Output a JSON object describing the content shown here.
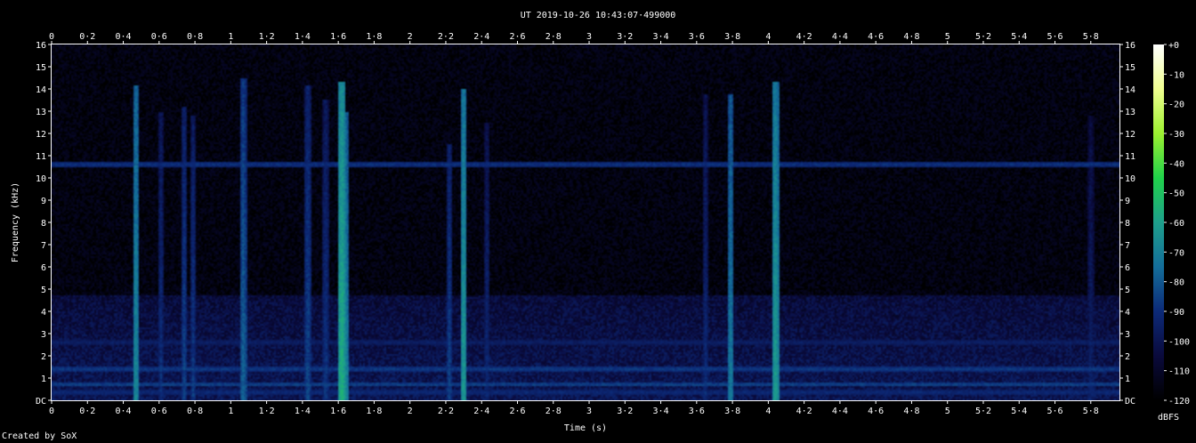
{
  "chart_data": {
    "type": "heatmap",
    "title": "UT 2019-10-26 10:43:07·499000",
    "xlabel": "Time (s)",
    "ylabel": "Frequency (kHz)",
    "xlim": [
      0,
      5.96
    ],
    "ylim": [
      0,
      16
    ],
    "x_ticks": [
      "0",
      "0·2",
      "0·4",
      "0·6",
      "0·8",
      "1",
      "1·2",
      "1·4",
      "1·6",
      "1·8",
      "2",
      "2·2",
      "2·4",
      "2·6",
      "2·8",
      "3",
      "3·2",
      "3·4",
      "3·6",
      "3·8",
      "4",
      "4·2",
      "4·4",
      "4·6",
      "4·8",
      "5",
      "5·2",
      "5·4",
      "5·6",
      "5·8"
    ],
    "x_tick_values": [
      0,
      0.2,
      0.4,
      0.6,
      0.8,
      1.0,
      1.2,
      1.4,
      1.6,
      1.8,
      2.0,
      2.2,
      2.4,
      2.6,
      2.8,
      3.0,
      3.2,
      3.4,
      3.6,
      3.8,
      4.0,
      4.2,
      4.4,
      4.6,
      4.8,
      5.0,
      5.2,
      5.4,
      5.6,
      5.8
    ],
    "y_ticks": [
      "DC",
      "1",
      "2",
      "3",
      "4",
      "5",
      "6",
      "7",
      "8",
      "9",
      "10",
      "11",
      "12",
      "13",
      "14",
      "15",
      "16"
    ],
    "y_tick_values": [
      0,
      1,
      2,
      3,
      4,
      5,
      6,
      7,
      8,
      9,
      10,
      11,
      12,
      13,
      14,
      15,
      16
    ],
    "colorbar": {
      "label": "dBFS",
      "range": [
        -120,
        0
      ],
      "ticks": [
        "+0",
        "-10",
        "-20",
        "-30",
        "-40",
        "-50",
        "-60",
        "-70",
        "-80",
        "-90",
        "-100",
        "-110",
        "-120"
      ],
      "tick_values": [
        0,
        -10,
        -20,
        -30,
        -40,
        -50,
        -60,
        -70,
        -80,
        -90,
        -100,
        -110,
        -120
      ],
      "colors": [
        "#000000",
        "#0a0a3c",
        "#0c2a78",
        "#146e9a",
        "#1ea08c",
        "#20d24a",
        "#9cf030",
        "#f0ff90",
        "#ffffff"
      ]
    },
    "features": {
      "horizontal_lines": [
        {
          "freq": 10.6,
          "level": -92
        },
        {
          "freq": 2.6,
          "level": -98
        },
        {
          "freq": 1.4,
          "level": -90
        },
        {
          "freq": 0.7,
          "level": -88
        },
        {
          "freq": 0.35,
          "level": -94
        }
      ],
      "vertical_streaks": [
        {
          "time": 0.47,
          "f_max": 14.2,
          "level": -70
        },
        {
          "time": 0.61,
          "f_max": 13.0,
          "level": -92
        },
        {
          "time": 0.74,
          "f_max": 13.2,
          "level": -88
        },
        {
          "time": 0.79,
          "f_max": 12.8,
          "level": -90
        },
        {
          "time": 1.07,
          "f_max": 14.5,
          "level": -80
        },
        {
          "time": 1.43,
          "f_max": 14.2,
          "level": -86
        },
        {
          "time": 1.53,
          "f_max": 13.5,
          "level": -90
        },
        {
          "time": 1.62,
          "f_max": 14.3,
          "level": -58
        },
        {
          "time": 1.64,
          "f_max": 13.0,
          "level": -70
        },
        {
          "time": 2.22,
          "f_max": 11.5,
          "level": -88
        },
        {
          "time": 2.3,
          "f_max": 14.0,
          "level": -66
        },
        {
          "time": 2.43,
          "f_max": 12.5,
          "level": -94
        },
        {
          "time": 3.65,
          "f_max": 13.8,
          "level": -94
        },
        {
          "time": 3.79,
          "f_max": 13.8,
          "level": -74
        },
        {
          "time": 4.04,
          "f_max": 14.3,
          "level": -64
        },
        {
          "time": 5.8,
          "f_max": 12.8,
          "level": -96
        }
      ],
      "background_level": -122,
      "low_band_level": -104,
      "low_band_top": 4.7
    }
  },
  "footer": {
    "credit": "Created by SoX"
  }
}
